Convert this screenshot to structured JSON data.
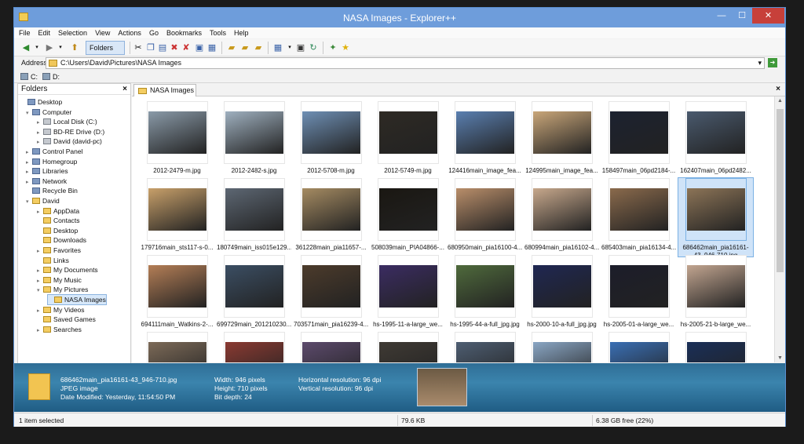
{
  "window": {
    "title": "NASA Images - Explorer++",
    "controls": {
      "minimize": "—",
      "maximize": "☐",
      "close": "✕"
    }
  },
  "menu": [
    "File",
    "Edit",
    "Selection",
    "View",
    "Actions",
    "Go",
    "Bookmarks",
    "Tools",
    "Help"
  ],
  "toolbar": {
    "folders_label": "Folders"
  },
  "address": {
    "label": "Address",
    "value": "C:\\Users\\David\\Pictures\\NASA Images"
  },
  "drives": [
    "C:",
    "D:"
  ],
  "folders_panel": {
    "title": "Folders",
    "close": "×",
    "items": [
      {
        "label": "Desktop",
        "icon": "desktop-icon"
      },
      {
        "label": "Computer",
        "icon": "computer-icon"
      },
      {
        "label": "Local Disk (C:)",
        "icon": "drive-icon"
      },
      {
        "label": "BD-RE Drive (D:)",
        "icon": "optical-drive-icon"
      },
      {
        "label": "David (david-pc)",
        "icon": "drive-icon"
      },
      {
        "label": "Control Panel",
        "icon": "control-panel-icon"
      },
      {
        "label": "Homegroup",
        "icon": "homegroup-icon"
      },
      {
        "label": "Libraries",
        "icon": "libraries-icon"
      },
      {
        "label": "Network",
        "icon": "network-icon"
      },
      {
        "label": "Recycle Bin",
        "icon": "recycle-bin-icon"
      },
      {
        "label": "David",
        "icon": "user-folder-icon"
      },
      {
        "label": "AppData",
        "icon": "folder-icon"
      },
      {
        "label": "Contacts",
        "icon": "folder-icon"
      },
      {
        "label": "Desktop",
        "icon": "folder-icon"
      },
      {
        "label": "Downloads",
        "icon": "folder-icon"
      },
      {
        "label": "Favorites",
        "icon": "folder-icon"
      },
      {
        "label": "Links",
        "icon": "folder-icon"
      },
      {
        "label": "My Documents",
        "icon": "folder-icon"
      },
      {
        "label": "My Music",
        "icon": "folder-icon"
      },
      {
        "label": "My Pictures",
        "icon": "folder-icon"
      },
      {
        "label": "NASA Images",
        "icon": "folder-icon",
        "selected": true
      },
      {
        "label": "My Videos",
        "icon": "folder-icon"
      },
      {
        "label": "Saved Games",
        "icon": "folder-icon"
      },
      {
        "label": "Searches",
        "icon": "folder-icon"
      }
    ]
  },
  "tab": {
    "label": "NASA Images",
    "close": "×"
  },
  "files": [
    {
      "name": "2012-2479-m.jpg",
      "color": "#8a9aa8"
    },
    {
      "name": "2012-2482-s.jpg",
      "color": "#9fb0bf"
    },
    {
      "name": "2012-5708-m.jpg",
      "color": "#6e8fb4"
    },
    {
      "name": "2012-5749-m.jpg",
      "color": "#2e2a24"
    },
    {
      "name": "124416main_image_fea...",
      "color": "#5a7fb0"
    },
    {
      "name": "124995main_image_fea...",
      "color": "#c9a679"
    },
    {
      "name": "158497main_06pd2184-...",
      "color": "#1c2230"
    },
    {
      "name": "162407main_06pd2482...",
      "color": "#4a5a6e"
    },
    {
      "name": "179716main_sts117-s-0...",
      "color": "#c8a06a"
    },
    {
      "name": "180749main_iss015e129...",
      "color": "#5d6773"
    },
    {
      "name": "361228main_pia11657-...",
      "color": "#a58b62"
    },
    {
      "name": "508039main_PIA04866-...",
      "color": "#1a1712"
    },
    {
      "name": "680950main_pia16100-4...",
      "color": "#b98e6a"
    },
    {
      "name": "680994main_pia16102-4...",
      "color": "#c7a88c"
    },
    {
      "name": "685403main_pia16134-4...",
      "color": "#8a6a4c"
    },
    {
      "name": "686462main_pia16161-43_946-710.jpg",
      "color": "#8c7457",
      "selected": true
    },
    {
      "name": "694111main_Watkins-2-...",
      "color": "#b47e56"
    },
    {
      "name": "699729main_201210230...",
      "color": "#3b4e63"
    },
    {
      "name": "703571main_pia16239-4...",
      "color": "#4c3b2b"
    },
    {
      "name": "hs-1995-11-a-large_we...",
      "color": "#3b2c62"
    },
    {
      "name": "hs-1995-44-a-full_jpg.jpg",
      "color": "#4f6a3c"
    },
    {
      "name": "hs-2000-10-a-full_jpg.jpg",
      "color": "#1f2752"
    },
    {
      "name": "hs-2005-01-a-large_we...",
      "color": "#1c1d2a"
    },
    {
      "name": "hs-2005-21-b-large_we...",
      "color": "#c2a590"
    },
    {
      "name": "",
      "color": "#7c6a58"
    },
    {
      "name": "",
      "color": "#8a3a32"
    },
    {
      "name": "",
      "color": "#5c4a6c"
    },
    {
      "name": "",
      "color": "#3f3a34"
    },
    {
      "name": "",
      "color": "#4e5e72"
    },
    {
      "name": "",
      "color": "#8aa6c4"
    },
    {
      "name": "",
      "color": "#3a6fb4"
    },
    {
      "name": "",
      "color": "#1a2f58"
    }
  ],
  "info": {
    "filename": "686462main_pia16161-43_946-710.jpg",
    "type": "JPEG image",
    "modified": "Date Modified: Yesterday, 11:54:50 PM",
    "width": "Width: 946 pixels",
    "height": "Height: 710 pixels",
    "depth": "Bit depth: 24",
    "hres": "Horizontal resolution: 96 dpi",
    "vres": "Vertical resolution: 96 dpi"
  },
  "status": {
    "selection": "1 item selected",
    "size": "79.6 KB",
    "free": "6.38 GB free (22%)"
  }
}
